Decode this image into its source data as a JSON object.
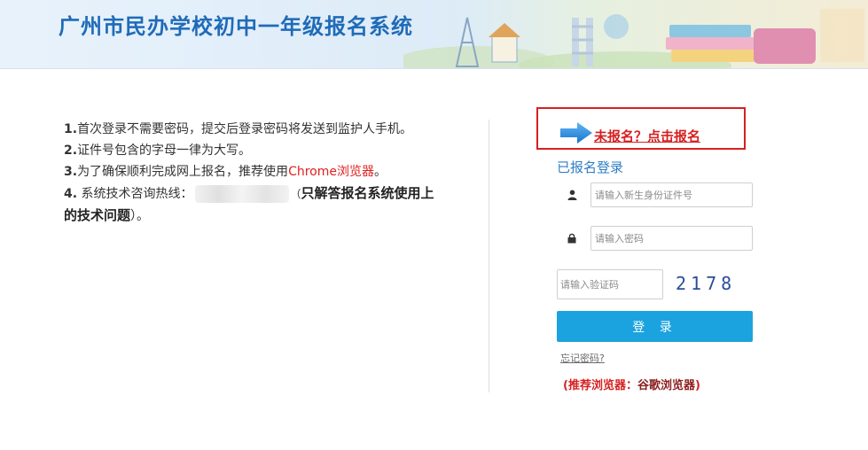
{
  "header": {
    "title": "广州市民办学校初中一年级报名系统"
  },
  "notes": {
    "item1_num": "1.",
    "item1_text": "首次登录不需要密码，提交后登录密码将发送到监护人手机。",
    "item2_num": "2.",
    "item2_text": "证件号包含的字母一律为大写。",
    "item3_num": "3.",
    "item3_text": "为了确保顺利完成网上报名，推荐使用",
    "item3_browser": "Chrome浏览器",
    "item3_end": "。",
    "item4_num": "4.",
    "item4_text": " 系统技术咨询热线：",
    "item4_open": "（",
    "item4_bold": "只解答报名系统使用上的技术问题",
    "item4_close": "）。"
  },
  "signup": {
    "link_label": "未报名？点击报名"
  },
  "login": {
    "heading": "已报名登录",
    "id_placeholder": "请输入新生身份证件号",
    "password_placeholder": "请输入密码",
    "captcha_placeholder": "请输入验证码",
    "captcha_code": "2178",
    "button_label": "登 录",
    "forgot_label": "忘记密码?",
    "browser_note_prefix": "(推荐浏览器：",
    "browser_note_name": "谷歌浏览器",
    "browser_note_suffix": ")"
  },
  "colors": {
    "title": "#1f6bb8",
    "accent": "#1ba3df",
    "warning": "#d62020"
  },
  "icons": {
    "user": "user-icon",
    "lock": "lock-icon",
    "arrow": "arrow-right-icon"
  }
}
